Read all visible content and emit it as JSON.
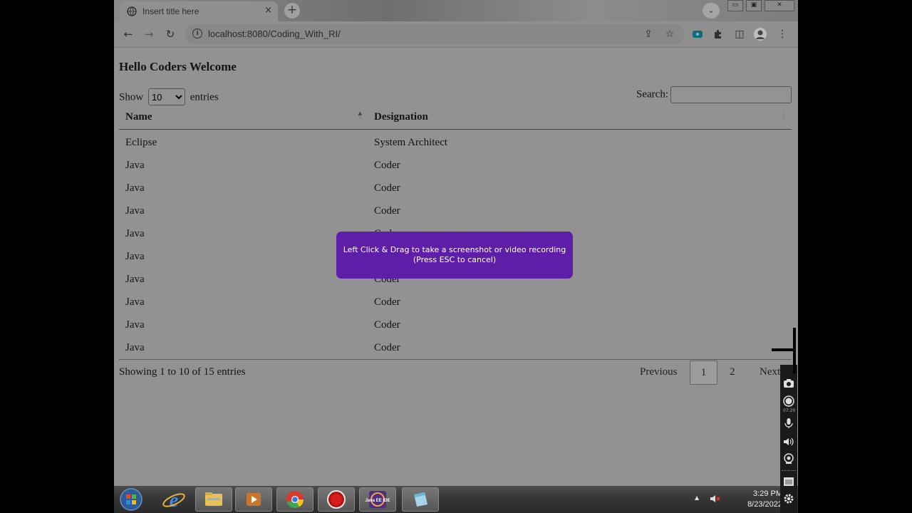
{
  "browser": {
    "tab_title": "Insert title here",
    "tab_close": "×",
    "new_tab": "+",
    "tab_search": "⌄",
    "url": "localhost:8080/Coding_With_RI/",
    "back": "←",
    "forward": "→",
    "reload": "↻",
    "window_controls": {
      "minimize": "▭",
      "restore": "▣",
      "close": "✕"
    },
    "toolbar_icons": {
      "share": "⇪",
      "bookmark": "☆",
      "extension": "⚙",
      "sidepanel": "◫",
      "menu": "⋮"
    }
  },
  "page": {
    "heading": "Hello Coders Welcome",
    "show_label": "Show",
    "entries_label": "entries",
    "page_size": "10",
    "search_label": "Search:",
    "search_value": "",
    "columns": [
      "Name",
      "Designation"
    ],
    "rows": [
      [
        "Eclipse",
        "System Architect"
      ],
      [
        "Java",
        "Coder"
      ],
      [
        "Java",
        "Coder"
      ],
      [
        "Java",
        "Coder"
      ],
      [
        "Java",
        "Coder"
      ],
      [
        "Java",
        "Coder"
      ],
      [
        "Java",
        "Coder"
      ],
      [
        "Java",
        "Coder"
      ],
      [
        "Java",
        "Coder"
      ],
      [
        "Java",
        "Coder"
      ]
    ],
    "info_text": "Showing 1 to 10 of 15 entries",
    "pagination": {
      "previous": "Previous",
      "pages": [
        "1",
        "2"
      ],
      "current": "1",
      "next": "Next"
    }
  },
  "overlay": {
    "line1": "Left Click & Drag to take a screenshot or video recording",
    "line2": "(Press ESC to cancel)"
  },
  "taskbar": {
    "items": [
      "start-orb",
      "internet-explorer",
      "file-explorer",
      "media-player",
      "chrome",
      "recorder",
      "java-ee-ide",
      "notepad"
    ],
    "java_label": "Java EE IDE",
    "time": "3:29 PM",
    "date": "8/23/2022"
  },
  "recorder_bar": {
    "timer": "07:20"
  },
  "colors": {
    "overlay_bg": "#5e1ea8",
    "page_bg": "#929292",
    "taskbar": "#383838"
  }
}
